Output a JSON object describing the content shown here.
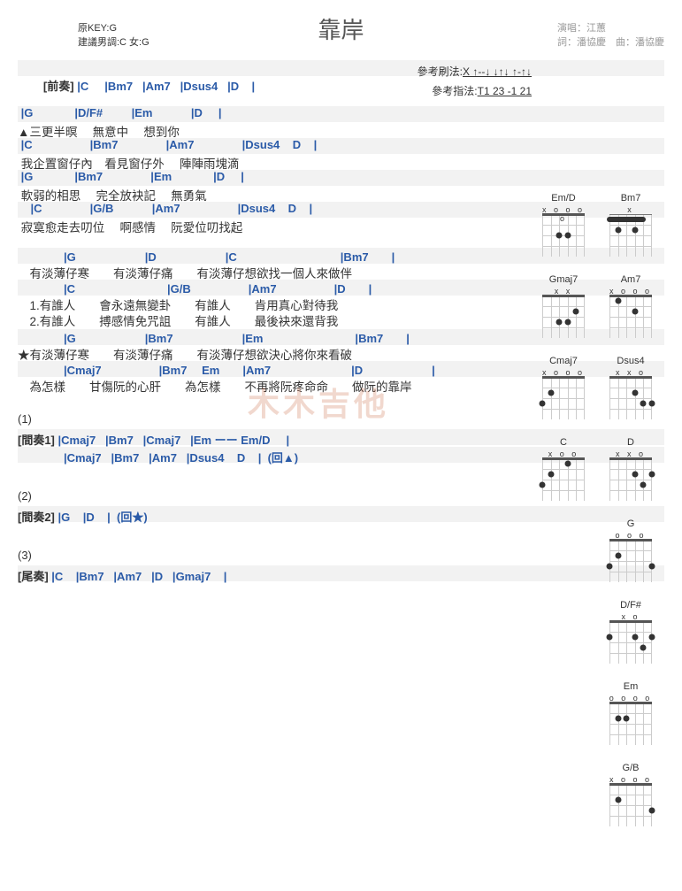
{
  "title": "靠岸",
  "key_info": {
    "line1": "原KEY:G",
    "line2": "建議男調:C 女:G"
  },
  "credits": {
    "line1": "演唱：江蕙",
    "line2": "詞：潘協慶　曲：潘協慶"
  },
  "ref": {
    "strum_label": "參考刷法:",
    "strum_pattern": "X ↑--↓ ↓↑↓ ↑-↑↓",
    "pick_label": "參考指法:",
    "pick_pattern": "T1 23 -1 21"
  },
  "intro": {
    "label": "[前奏]",
    "chords": "|C     |Bm7   |Am7   |Dsus4   |D    |"
  },
  "verse1": {
    "row1c": " |G             |D/F#         |Em            |D     |",
    "row1l": "▲三更半暝　 無意中　 想到你",
    "row2c": " |C                  |Bm7               |Am7               |Dsus4    D    |",
    "row2l": " 我企置窗仔內　看見窗仔外　 陣陣雨塊滴",
    "row3c": " |G             |Bm7               |Em             |D     |",
    "row3l": " 軟弱的相思　 完全放袂記　 無勇氣",
    "row4c": "    |C               |G/B            |Am7                  |Dsus4    D    |",
    "row4l": " 寂寞愈走去叨位　 啊感情　 阮愛位叨找起"
  },
  "chorus1": {
    "row1c": "　　　　|G　　　　　　|D　　　　　　|C　　　　　　　　　|Bm7　　|",
    "row1l": "　有淡薄仔寒　　有淡薄仔痛　　有淡薄仔想欲找一個人來做伴",
    "row2c": "　　　　|C　　　　　　　　|G/B　　　　　|Am7　　　　　|D　　|",
    "row2l1": "　1.有誰人　　會永遠無變卦　　有誰人　　肯用真心對待我",
    "row2l2": "　2.有誰人　　搏感情免咒詛　　有誰人　　最後袂來還背我",
    "row3c": "　　　　|G　　　　　　|Bm7　　　　　　|Em　　　　　　　　|Bm7　　|",
    "row3l": "★有淡薄仔寒　　有淡薄仔痛　　有淡薄仔想欲決心將你來看破",
    "row4c": "　　　　|Cmaj7　　　　　|Bm7　 Em　　|Am7　　　　　　　|D　　　　　　|",
    "row4l": "　為怎樣　　甘傷阮的心肝　　為怎樣　　不再將阮疼命命　　做阮的靠岸"
  },
  "inter1": {
    "num": "(1)",
    "label": "[間奏1]",
    "line1": "|Cmaj7   |Bm7   |Cmaj7   |Em ーー Em/D     |",
    "line2": "|Cmaj7   |Bm7   |Am7   |Dsus4    D    |  (回▲)"
  },
  "inter2": {
    "num": "(2)",
    "label": "[間奏2]",
    "line1": "|G    |D    |  (回★)"
  },
  "outro": {
    "num": "(3)",
    "label": "[尾奏]",
    "line1": "|C    |Bm7   |Am7   |D   |Gmaj7    |"
  },
  "diagrams": [
    [
      {
        "name": "Em/D",
        "top": "x  o o o o",
        "nut": true,
        "dots": [
          [
            3,
            24
          ],
          [
            4,
            24
          ]
        ]
      },
      {
        "name": "Bm7",
        "top": "x",
        "nut": false,
        "fret": "2",
        "barre": [
          1,
          5,
          6
        ],
        "dots": [
          [
            2,
            18
          ],
          [
            4,
            18
          ]
        ]
      }
    ],
    [
      {
        "name": "Gmaj7",
        "top": "x x",
        "nut": true,
        "dots": [
          [
            5,
            18
          ],
          [
            4,
            30
          ],
          [
            3,
            30
          ]
        ]
      },
      {
        "name": "Am7",
        "top": "x o   o   o",
        "nut": true,
        "dots": [
          [
            2,
            6
          ],
          [
            4,
            18
          ]
        ]
      }
    ],
    [
      {
        "name": "Cmaj7",
        "top": "x     o o o",
        "nut": true,
        "dots": [
          [
            1,
            30
          ],
          [
            2,
            18
          ]
        ]
      },
      {
        "name": "Dsus4",
        "top": "x x o",
        "nut": true,
        "dots": [
          [
            4,
            18
          ],
          [
            5,
            30
          ],
          [
            6,
            30
          ]
        ]
      }
    ],
    [
      {
        "name": "C",
        "top": "x     o   o",
        "nut": true,
        "dots": [
          [
            1,
            30
          ],
          [
            2,
            18
          ],
          [
            4,
            6
          ]
        ]
      },
      {
        "name": "D",
        "top": "x x o",
        "nut": true,
        "dots": [
          [
            4,
            18
          ],
          [
            6,
            18
          ],
          [
            5,
            30
          ]
        ]
      }
    ],
    [
      {
        "name": "G",
        "top": "    o o o",
        "nut": true,
        "dots": [
          [
            1,
            30
          ],
          [
            2,
            18
          ],
          [
            6,
            30
          ]
        ]
      }
    ],
    [
      {
        "name": "D/F#",
        "top": "  x o",
        "nut": true,
        "dots": [
          [
            1,
            18
          ],
          [
            4,
            18
          ],
          [
            6,
            18
          ],
          [
            5,
            30
          ]
        ]
      }
    ],
    [
      {
        "name": "Em",
        "top": "o   o o o",
        "nut": true,
        "dots": [
          [
            2,
            18
          ],
          [
            3,
            18
          ]
        ]
      }
    ],
    [
      {
        "name": "G/B",
        "top": "x   o o o",
        "nut": true,
        "dots": [
          [
            2,
            18
          ],
          [
            6,
            30
          ]
        ]
      }
    ]
  ],
  "watermark": "木木吉他"
}
